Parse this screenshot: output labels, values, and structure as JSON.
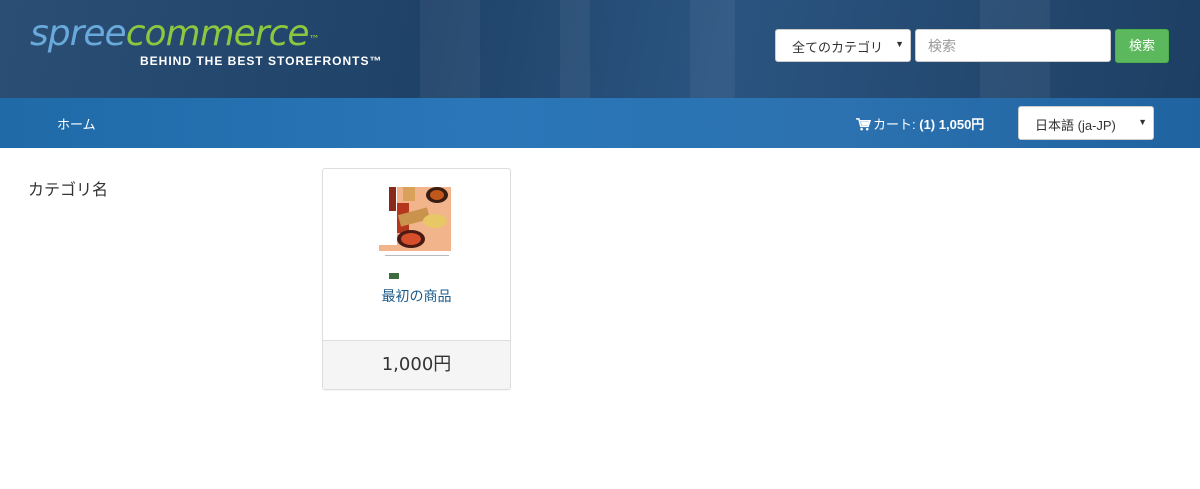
{
  "header": {
    "logo": {
      "word_spree": "spree",
      "word_commerce": "commerce",
      "tm": "™",
      "tagline": "BEHIND THE BEST STOREFRONTS™"
    },
    "search": {
      "category_selected": "全てのカテゴリ",
      "placeholder": "検索",
      "button_label": "検索"
    }
  },
  "nav": {
    "home_label": "ホーム",
    "cart": {
      "label": "カート:",
      "count": "(1)",
      "total": "1,050円"
    },
    "language_selected": "日本語 (ja-JP)"
  },
  "main": {
    "taxon_title": "カテゴリ名",
    "products": [
      {
        "name": "最初の商品",
        "price": "1,000円"
      }
    ]
  },
  "colors": {
    "header_bg": "#1f4268",
    "nav_bg": "#2a76b8",
    "search_button": "#5cb85c",
    "logo_blue": "#6aa9dc",
    "logo_green": "#8dc63f",
    "product_link": "#1c5a8a"
  },
  "icons": [
    "shopping-cart-icon",
    "chevron-down-icon"
  ]
}
